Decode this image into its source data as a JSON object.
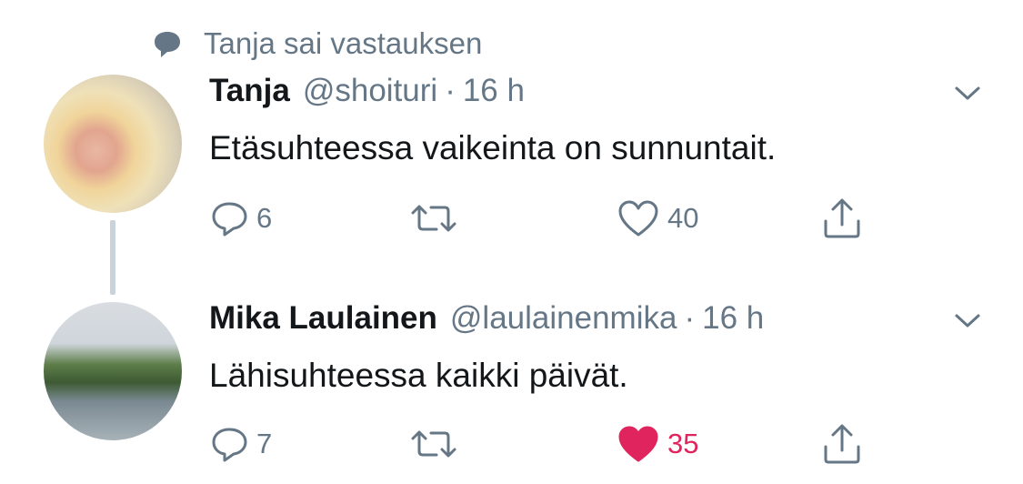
{
  "context": {
    "icon": "speech-bubble-icon",
    "text": "Tanja sai vastauksen"
  },
  "tweets": [
    {
      "name": "Tanja",
      "handle": "@shoituri",
      "separator": "·",
      "time": "16 h",
      "text": "Etäsuhteessa vaikeinta on sunnuntait.",
      "reply_count": "6",
      "like_count": "40",
      "liked": false
    },
    {
      "name": "Mika Laulainen",
      "handle": "@laulainenmika",
      "separator": "·",
      "time": "16 h",
      "text": "Lähisuhteessa kaikki päivät.",
      "reply_count": "7",
      "like_count": "35",
      "liked": true
    }
  ],
  "colors": {
    "text": "#14171a",
    "muted": "#657786",
    "like": "#e0245e",
    "thread_line": "#c8d3dc"
  }
}
